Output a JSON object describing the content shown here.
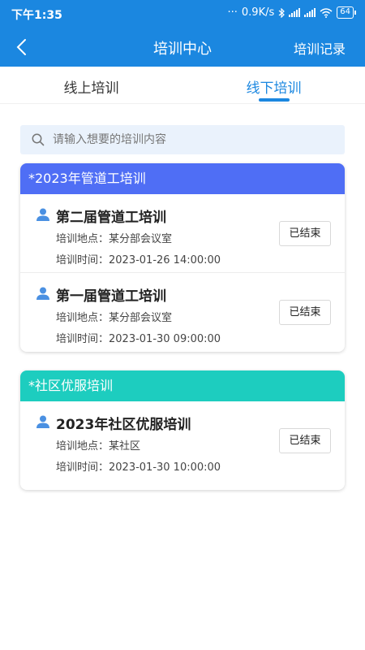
{
  "status_bar": {
    "time": "下午1:35",
    "net_speed": "0.9K/s",
    "battery": "64"
  },
  "nav": {
    "title": "培训中心",
    "action_label": "培训记录"
  },
  "tabs": [
    {
      "label": "线上培训",
      "active": false
    },
    {
      "label": "线下培训",
      "active": true
    }
  ],
  "search": {
    "placeholder": "请输入想要的培训内容",
    "value": ""
  },
  "groups": [
    {
      "title": "*2023年管道工培训",
      "color": "#4f6ef5",
      "items": [
        {
          "name": "第二届管道工培训",
          "location": "培训地点：某分部会议室",
          "time": "培训时间：2023-01-26 14:00:00",
          "status": "已结束"
        },
        {
          "name": "第一届管道工培训",
          "location": "培训地点：某分部会议室",
          "time": "培训时间：2023-01-30 09:00:00",
          "status": "已结束"
        }
      ]
    },
    {
      "title": "*社区优服培训",
      "color": "#1dcdbf",
      "items": [
        {
          "name": "2023年社区优服培训",
          "location": "培训地点：某社区",
          "time": "培训时间：2023-01-30 10:00:00",
          "status": "已结束"
        }
      ]
    }
  ],
  "colors": {
    "primary": "#1b87e0",
    "person_icon": "#4a90e2"
  },
  "icons": {
    "back": "chevron-left-icon",
    "search": "search-icon",
    "person": "person-icon"
  }
}
